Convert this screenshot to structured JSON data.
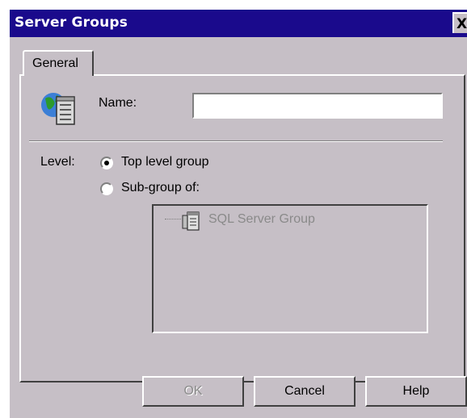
{
  "window": {
    "title": "Server Groups",
    "close_glyph": "X"
  },
  "tabs": [
    {
      "label": "General"
    }
  ],
  "name_field": {
    "label": "Name:",
    "value": ""
  },
  "level": {
    "label": "Level:",
    "options": [
      {
        "label": "Top level group",
        "selected": true
      },
      {
        "label": "Sub-group of:",
        "selected": false
      }
    ]
  },
  "tree": {
    "items": [
      {
        "label": "SQL Server Group",
        "icon": "server-group-icon",
        "disabled": true
      }
    ]
  },
  "buttons": {
    "ok": "OK",
    "cancel": "Cancel",
    "help": "Help"
  },
  "colors": {
    "titlebar": "#1a0a8c",
    "dialog_bg": "#c6bfc6"
  }
}
